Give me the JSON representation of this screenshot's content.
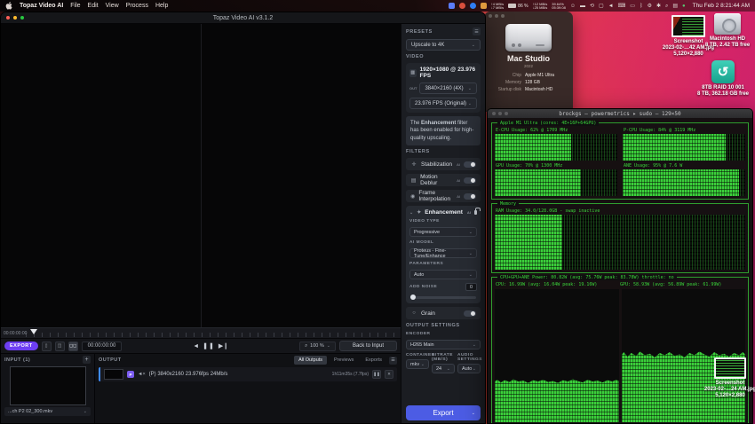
{
  "menubar": {
    "app_name": "Topaz Video AI",
    "menus": [
      "File",
      "Edit",
      "View",
      "Process",
      "Help"
    ],
    "stats": {
      "net1_up": "↑4 MB/s",
      "net1_down": "↓7 MB/s",
      "battery": "86 %",
      "net2_up": "↑12 MB/s",
      "net2_down": "↓25 MB/s",
      "cpu_pct": "39.64%",
      "cpu_time": "05:39:08",
      "clock": "Thu Feb 2  8:21:44 AM"
    }
  },
  "desktop": {
    "screenshot_top": {
      "line1": "Screenshot",
      "line2": "2023-02-…42 AM.jpg",
      "line3": "5,120×2,880"
    },
    "macintosh_hd": {
      "name": "Macintosh HD",
      "sub": "8 TB, 2.42 TB free"
    },
    "raid": {
      "name": "8TB RAID 10 001",
      "sub": "8 TB, 362.18 GB free"
    },
    "screenshot_bottom": {
      "line1": "Screenshot",
      "line2": "2023-02-…24 AM.jpg",
      "line3": "5,120×2,880"
    }
  },
  "about": {
    "model": "Mac Studio",
    "year": "2022",
    "specs": [
      {
        "label": "Chip",
        "value": "Apple M1 Ultra"
      },
      {
        "label": "Memory",
        "value": "128 GB"
      },
      {
        "label": "Startup disk",
        "value": "Macintosh HD"
      }
    ]
  },
  "terminal": {
    "title": "brockgs — powermetrics ▸ sudo — 129×50",
    "soc_header": "Apple M1 Ultra (cores: 4E+16P+64GPU)",
    "gauges": [
      {
        "label": "E-CPU Usage: 62% @ 1709 MHz",
        "pct": 62
      },
      {
        "label": "P-CPU Usage: 84% @ 3119 MHz",
        "pct": 84
      },
      {
        "label": "GPU Usage: 70% @ 1300 MHz",
        "pct": 70
      },
      {
        "label": "ANE Usage: 95% @ 7.6 W",
        "pct": 95
      }
    ],
    "memory_title": "Memory",
    "ram_label": "RAM Usage: 34.0/128.0GB - swap inactive",
    "ram_pct": 27,
    "power_header": "CPU+GPU+ANE Power: 80.82W (avg: 75.76W peak: 83.78W) throttle: no",
    "cpu_power_label": "CPU: 16.99W (avg: 16.04W peak: 19.16W)",
    "gpu_power_label": "GPU: 58.93W (avg: 56.89W peak: 61.99W)",
    "cpu_power_pct": 34,
    "gpu_power_pct": 56
  },
  "topaz": {
    "window_title": "Topaz Video AI  v3.1.2",
    "timeline": {
      "start": "00:00:00:00"
    },
    "transport": {
      "export": "EXPORT",
      "timecode": "00:00:00:00",
      "zoom": "100 %",
      "back": "Back to Input"
    },
    "input": {
      "header": "INPUT (1)",
      "filename": "...ch P2 02_300.mkv"
    },
    "output": {
      "header": "OUTPUT",
      "tabs": [
        "All Outputs",
        "Previews",
        "Exports"
      ],
      "badge": "P",
      "row_info": "(P)  3840x2160  23.976fps  24Mb/s",
      "row_eta": "1h11m35s (7.7fps)"
    },
    "panel": {
      "presets_header": "PRESETS",
      "preset": "Upscale to 4K",
      "video_header": "VIDEO",
      "source": "1920×1080 @ 23.976 FPS",
      "out_tag": "OUT",
      "out_res": "3840×2160 (4X)",
      "out_fps": "23.976 FPS (Original)",
      "note_1": "The ",
      "note_b": "Enhancement",
      "note_2": " filter has been enabled for high-quality upscaling.",
      "filters_header": "FILTERS",
      "filters": [
        {
          "label": "Stabilization",
          "sup": "AI"
        },
        {
          "label": "Motion Deblur",
          "sup": "AI"
        },
        {
          "label": "Frame Interpolation",
          "sup": "AI"
        }
      ],
      "enh": {
        "label": "Enhancement",
        "sup": "AI",
        "video_type_label": "VIDEO TYPE",
        "video_type": "Progressive",
        "ai_model_label": "AI MODEL",
        "ai_model": "Proteus - Fine-Tune/Enhance",
        "parameters_label": "PARAMETERS",
        "parameters": "Auto",
        "noise_label": "ADD NOISE",
        "noise_value": "0"
      },
      "grain": "Grain",
      "output_header": "OUTPUT SETTINGS",
      "encoder_label": "ENCODER",
      "encoder": "H265 Main",
      "container_label": "CONTAINER",
      "container": "mkv",
      "bitrate_label": "BITRATE (MB/S)",
      "bitrate": "24",
      "audio_label": "AUDIO SETTINGS",
      "audio": "Auto",
      "export": "Export"
    }
  },
  "colors": {
    "accent_blue": "#4c5ce4",
    "accent_purple": "#6d3ef2",
    "terminal_green": "#3ad23a",
    "selection_blue": "#3f8cff"
  }
}
